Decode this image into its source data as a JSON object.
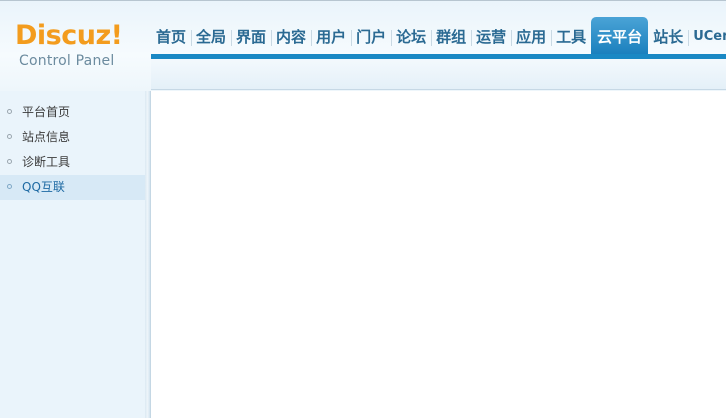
{
  "logo": {
    "title": "Discuz!",
    "subtitle": "Control Panel"
  },
  "nav": {
    "items": [
      {
        "label": "首页"
      },
      {
        "label": "全局"
      },
      {
        "label": "界面"
      },
      {
        "label": "内容"
      },
      {
        "label": "用户"
      },
      {
        "label": "门户"
      },
      {
        "label": "论坛"
      },
      {
        "label": "群组"
      },
      {
        "label": "运营"
      },
      {
        "label": "应用"
      },
      {
        "label": "工具"
      },
      {
        "label": "云平台"
      },
      {
        "label": "站长"
      },
      {
        "label": "UCenter"
      }
    ],
    "active_index": 11
  },
  "sidebar": {
    "items": [
      {
        "label": "平台首页"
      },
      {
        "label": "站点信息"
      },
      {
        "label": "诊断工具"
      },
      {
        "label": "QQ互联"
      }
    ],
    "active_index": 3
  },
  "colors": {
    "accent": "#1a88c4",
    "logo": "#f39c1e",
    "nav_text": "#2b6a93"
  }
}
